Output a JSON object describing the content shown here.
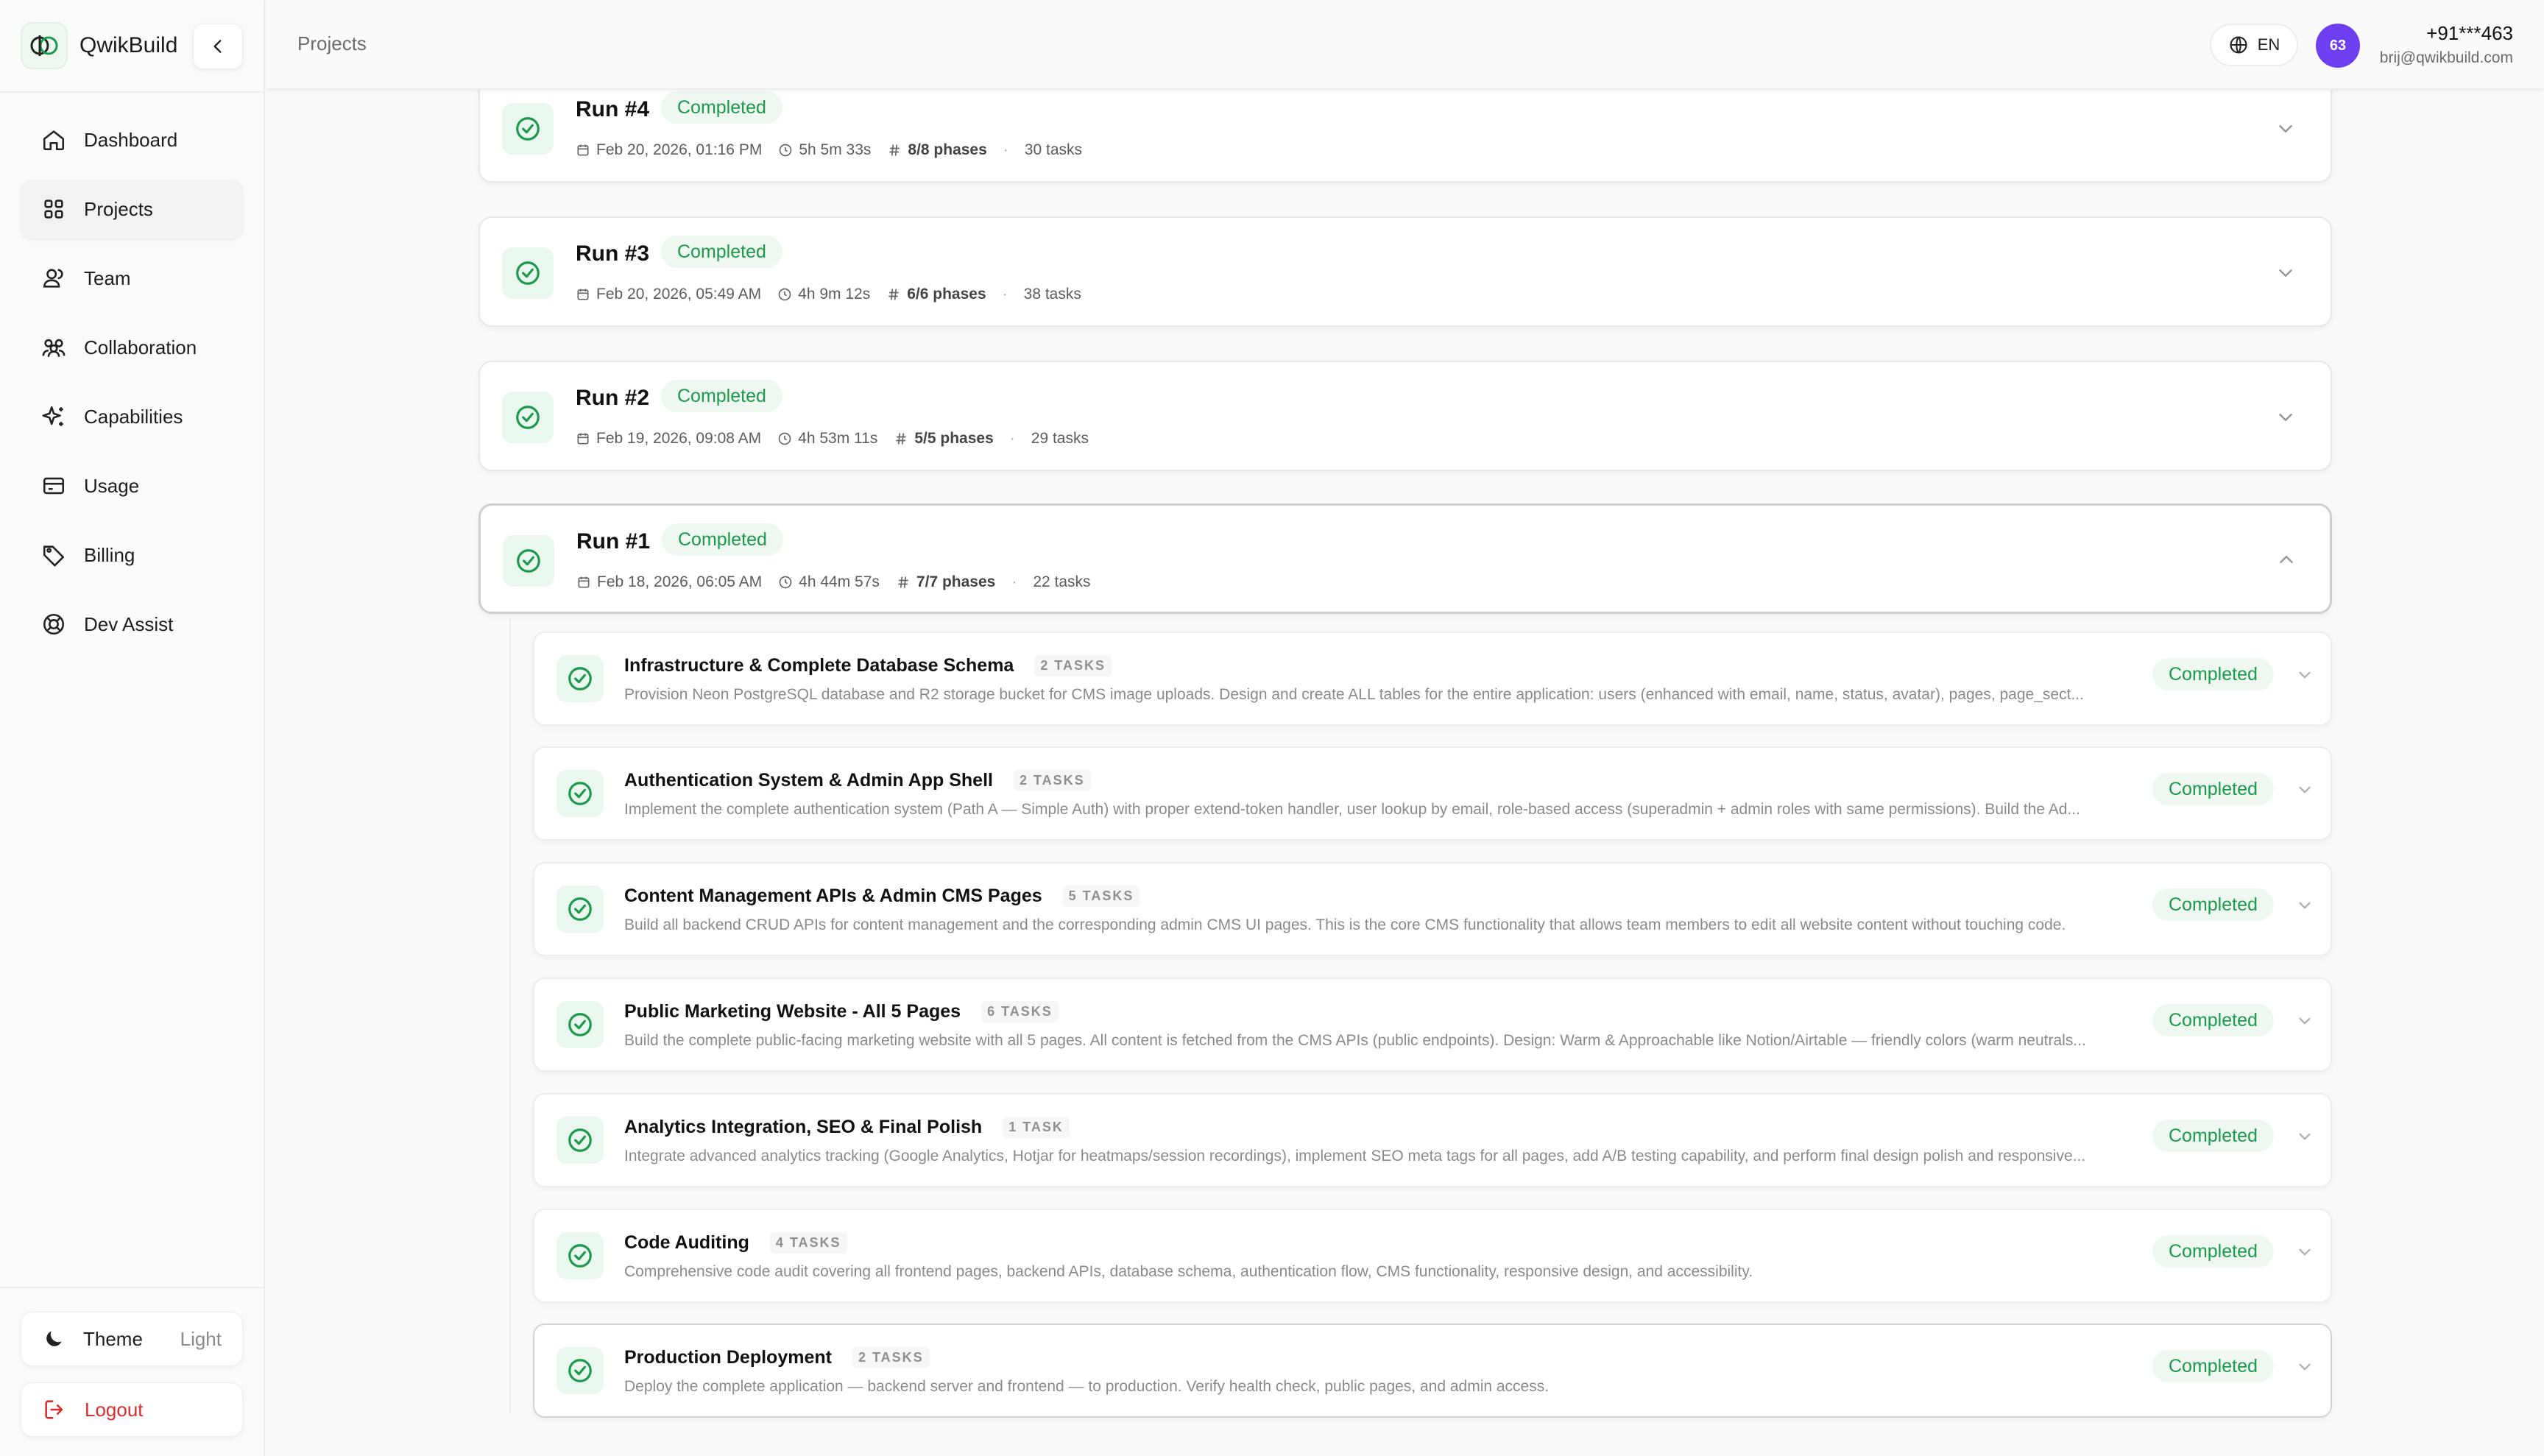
{
  "app": {
    "name": "QwikBuild"
  },
  "header": {
    "breadcrumb": "Projects",
    "language": "EN",
    "avatar_initials": "63",
    "user_phone": "+91***463",
    "user_email": "brij@qwikbuild.com"
  },
  "sidebar": {
    "items": [
      {
        "label": "Dashboard",
        "icon": "home-icon"
      },
      {
        "label": "Projects",
        "icon": "grid-icon"
      },
      {
        "label": "Team",
        "icon": "users-icon"
      },
      {
        "label": "Collaboration",
        "icon": "collaboration-icon"
      },
      {
        "label": "Capabilities",
        "icon": "sparkles-icon"
      },
      {
        "label": "Usage",
        "icon": "card-icon"
      },
      {
        "label": "Billing",
        "icon": "tag-icon"
      },
      {
        "label": "Dev Assist",
        "icon": "lifebuoy-icon"
      }
    ],
    "theme_label": "Theme",
    "theme_value": "Light",
    "logout_label": "Logout"
  },
  "runs": [
    {
      "title": "Run #4",
      "status": "Completed",
      "date": "Feb 20, 2026, 01:16 PM",
      "duration": "5h 5m 33s",
      "phases": "8/8 phases",
      "tasks": "30 tasks"
    },
    {
      "title": "Run #3",
      "status": "Completed",
      "date": "Feb 20, 2026, 05:49 AM",
      "duration": "4h 9m 12s",
      "phases": "6/6 phases",
      "tasks": "38 tasks"
    },
    {
      "title": "Run #2",
      "status": "Completed",
      "date": "Feb 19, 2026, 09:08 AM",
      "duration": "4h 53m 11s",
      "phases": "5/5 phases",
      "tasks": "29 tasks"
    },
    {
      "title": "Run #1",
      "status": "Completed",
      "date": "Feb 18, 2026, 06:05 AM",
      "duration": "4h 44m 57s",
      "phases": "7/7 phases",
      "tasks": "22 tasks"
    }
  ],
  "phases": [
    {
      "title": "Infrastructure & Complete Database Schema",
      "task_count": "2 TASKS",
      "status": "Completed",
      "description": "Provision Neon PostgreSQL database and R2 storage bucket for CMS image uploads. Design and create ALL tables for the entire application: users (enhanced with email, name, status, avatar), pages, page_sect..."
    },
    {
      "title": "Authentication System & Admin App Shell",
      "task_count": "2 TASKS",
      "status": "Completed",
      "description": "Implement the complete authentication system (Path A — Simple Auth) with proper extend-token handler, user lookup by email, role-based access (superadmin + admin roles with same permissions). Build the Ad..."
    },
    {
      "title": "Content Management APIs & Admin CMS Pages",
      "task_count": "5 TASKS",
      "status": "Completed",
      "description": "Build all backend CRUD APIs for content management and the corresponding admin CMS UI pages. This is the core CMS functionality that allows team members to edit all website content without touching code."
    },
    {
      "title": "Public Marketing Website - All 5 Pages",
      "task_count": "6 TASKS",
      "status": "Completed",
      "description": "Build the complete public-facing marketing website with all 5 pages. All content is fetched from the CMS APIs (public endpoints). Design: Warm & Approachable like Notion/Airtable — friendly colors (warm neutrals..."
    },
    {
      "title": "Analytics Integration, SEO & Final Polish",
      "task_count": "1 TASK",
      "status": "Completed",
      "description": "Integrate advanced analytics tracking (Google Analytics, Hotjar for heatmaps/session recordings), implement SEO meta tags for all pages, add A/B testing capability, and perform final design polish and responsive..."
    },
    {
      "title": "Code Auditing",
      "task_count": "4 TASKS",
      "status": "Completed",
      "description": "Comprehensive code audit covering all frontend pages, backend APIs, database schema, authentication flow, CMS functionality, responsive design, and accessibility."
    },
    {
      "title": "Production Deployment",
      "task_count": "2 TASKS",
      "status": "Completed",
      "description": "Deploy the complete application — backend server and frontend — to production. Verify health check, public pages, and admin access."
    }
  ],
  "colors": {
    "accent_green": "#1b9a4b",
    "avatar_purple": "#6d3ff0",
    "logout_red": "#d92d2d"
  }
}
